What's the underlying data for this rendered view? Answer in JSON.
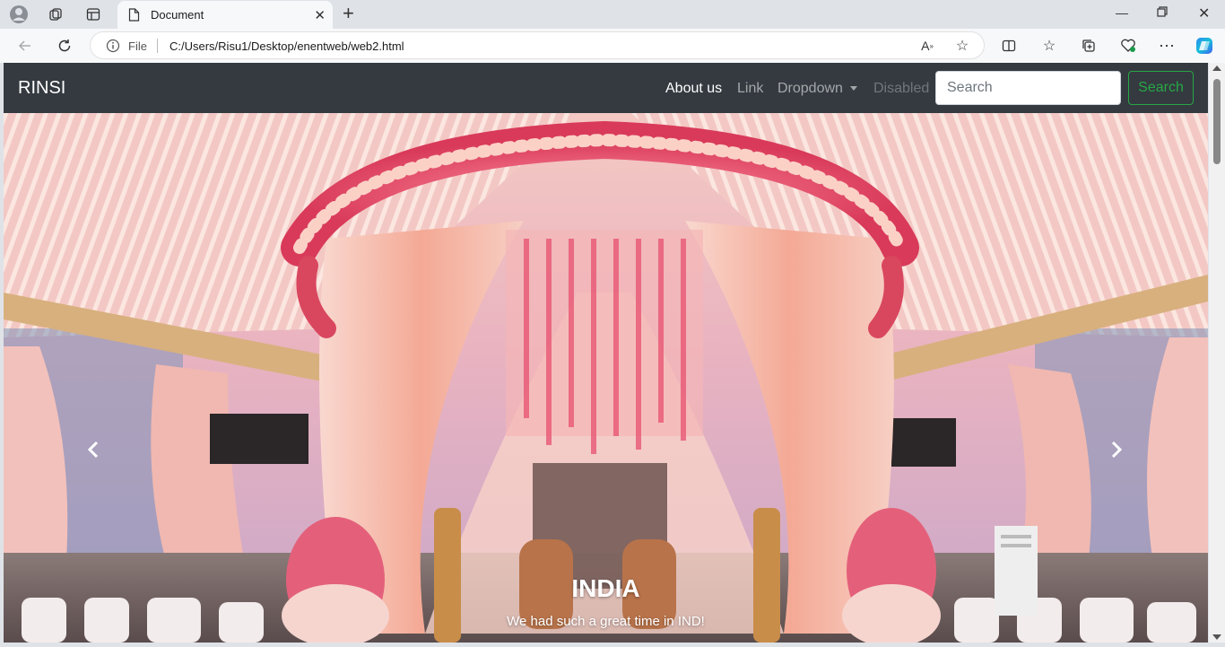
{
  "browser": {
    "tab_title": "Document",
    "address_scheme": "File",
    "address_url": "C:/Users/Risu1/Desktop/enentweb/web2.html"
  },
  "navbar": {
    "brand": "RINSI",
    "links": [
      {
        "label": "About us",
        "state": "active"
      },
      {
        "label": "Link",
        "state": "normal"
      },
      {
        "label": "Dropdown",
        "state": "dropdown"
      },
      {
        "label": "Disabled",
        "state": "disabled"
      }
    ],
    "search_placeholder": "Search",
    "search_button": "Search"
  },
  "carousel": {
    "caption_title": "INDIA",
    "caption_text": "We had such a great time in IND!",
    "image": "wedding-mandap-photo"
  },
  "colors": {
    "navbar_bg": "#343a40",
    "search_green": "#28a745",
    "link_active": "#ffffff",
    "link_normal": "rgba(255,255,255,0.55)",
    "link_disabled": "rgba(255,255,255,0.3)"
  }
}
